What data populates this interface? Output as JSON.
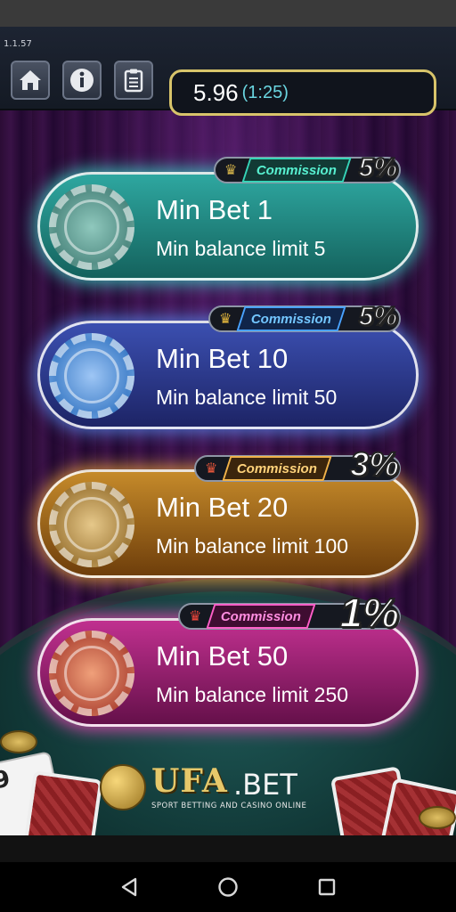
{
  "app": {
    "version": "1.1.57"
  },
  "toolbar": {
    "home_icon": "home-icon",
    "info_icon": "info-icon",
    "history_icon": "clipboard-icon"
  },
  "balance": {
    "value": "5.96",
    "timer": "(1:25)"
  },
  "rooms": [
    {
      "title": "Min Bet 1",
      "subtitle": "Min balance limit 5",
      "commission_label": "Commission",
      "commission_value": "5%",
      "theme": "#2ea7a0",
      "chip": "K"
    },
    {
      "title": "Min Bet 10",
      "subtitle": "Min balance limit 50",
      "commission_label": "Commission",
      "commission_value": "5%",
      "theme": "#3b4fb0",
      "chip": "Q"
    },
    {
      "title": "Min Bet 20",
      "subtitle": "Min balance limit 100",
      "commission_label": "Commission",
      "commission_value": "3%",
      "theme": "#c58a2a",
      "chip": "J"
    },
    {
      "title": "Min Bet 50",
      "subtitle": "Min balance limit 250",
      "commission_label": "Commission",
      "commission_value": "1%",
      "theme": "#c0308f",
      "chip": "A"
    }
  ],
  "table_cards": {
    "left_card": "9"
  },
  "logo": {
    "name": "UFA",
    "suffix": ".BET",
    "tagline": "SPORT BETTING AND CASINO ONLINE"
  },
  "navbar": {
    "back_icon": "back-triangle-icon",
    "home_icon": "home-circle-icon",
    "recents_icon": "recents-square-icon"
  }
}
